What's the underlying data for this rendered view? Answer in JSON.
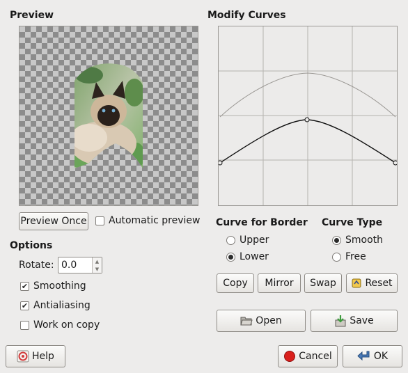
{
  "preview": {
    "title": "Preview",
    "preview_once_label": "Preview Once",
    "automatic_preview_label": "Automatic preview",
    "automatic_preview_checked": false
  },
  "curves": {
    "title": "Modify Curves"
  },
  "border": {
    "title": "Curve for Border",
    "options": [
      {
        "label": "Upper",
        "selected": false
      },
      {
        "label": "Lower",
        "selected": true
      }
    ]
  },
  "curve_type": {
    "title": "Curve Type",
    "options": [
      {
        "label": "Smooth",
        "selected": true
      },
      {
        "label": "Free",
        "selected": false
      }
    ]
  },
  "curve_buttons": {
    "copy": "Copy",
    "mirror": "Mirror",
    "swap": "Swap",
    "reset": "Reset"
  },
  "file_buttons": {
    "open": "Open",
    "save": "Save"
  },
  "options": {
    "title": "Options",
    "rotate_label": "Rotate:",
    "rotate_value": "0.0",
    "smoothing_label": "Smoothing",
    "smoothing_checked": true,
    "antialiasing_label": "Antialiasing",
    "antialiasing_checked": true,
    "work_on_copy_label": "Work on copy",
    "work_on_copy_checked": false
  },
  "dialog_buttons": {
    "help": "Help",
    "cancel": "Cancel",
    "ok": "OK"
  },
  "icons": {
    "reset": "reset-icon",
    "open": "folder-open-icon",
    "save": "save-icon",
    "help": "help-icon",
    "cancel": "cancel-icon",
    "ok": "ok-arrow-icon"
  }
}
